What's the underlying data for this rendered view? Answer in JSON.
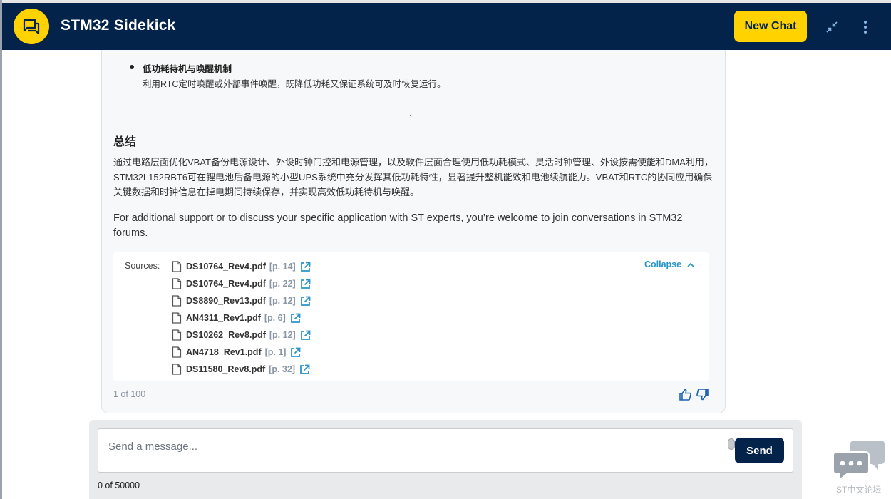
{
  "header": {
    "title": "STM32 Sidekick",
    "new_chat_label": "New Chat"
  },
  "message": {
    "bullet_title": "低功耗待机与唤醒机制",
    "bullet_desc": "利用RTC定时唤醒或外部事件唤醒，既降低功耗又保证系统可及时恢复运行。",
    "summary_heading": "总结",
    "summary_text": "通过电路层面优化VBAT备份电源设计、外设时钟门控和电源管理，以及软件层面合理使用低功耗模式、灵活时钟管理、外设按需使能和DMA利用，STM32L152RBT6可在锂电池后备电源的小型UPS系统中充分发挥其低功耗特性，显著提升整机能效和电池续航能力。VBAT和RTC的协同应用确保关键数据和时钟信息在掉电期间持续保存，并实现高效低功耗待机与唤醒。",
    "support_text": "For additional support or to discuss your specific application with ST experts, you’re welcome to join conversations in STM32 forums.",
    "sources": {
      "label": "Sources:",
      "collapse_label": "Collapse",
      "items": [
        {
          "name": "DS10764_Rev4.pdf",
          "page": "[p. 14]"
        },
        {
          "name": "DS10764_Rev4.pdf",
          "page": "[p. 22]"
        },
        {
          "name": "DS8890_Rev13.pdf",
          "page": "[p. 12]"
        },
        {
          "name": "AN4311_Rev1.pdf",
          "page": "[p. 6]"
        },
        {
          "name": "DS10262_Rev8.pdf",
          "page": "[p. 12]"
        },
        {
          "name": "AN4718_Rev1.pdf",
          "page": "[p. 1]"
        },
        {
          "name": "DS11580_Rev8.pdf",
          "page": "[p. 32]"
        }
      ]
    },
    "counter": "1 of 100"
  },
  "composer": {
    "placeholder": "Send a message...",
    "send_label": "Send",
    "char_count": "0 of 50000"
  },
  "forum_widget": {
    "label": "ST中文论坛"
  },
  "colors": {
    "header_bg": "#03234b",
    "accent_yellow": "#ffd200",
    "link_blue": "#2a95c9",
    "icon_blue": "#1e64b4"
  }
}
